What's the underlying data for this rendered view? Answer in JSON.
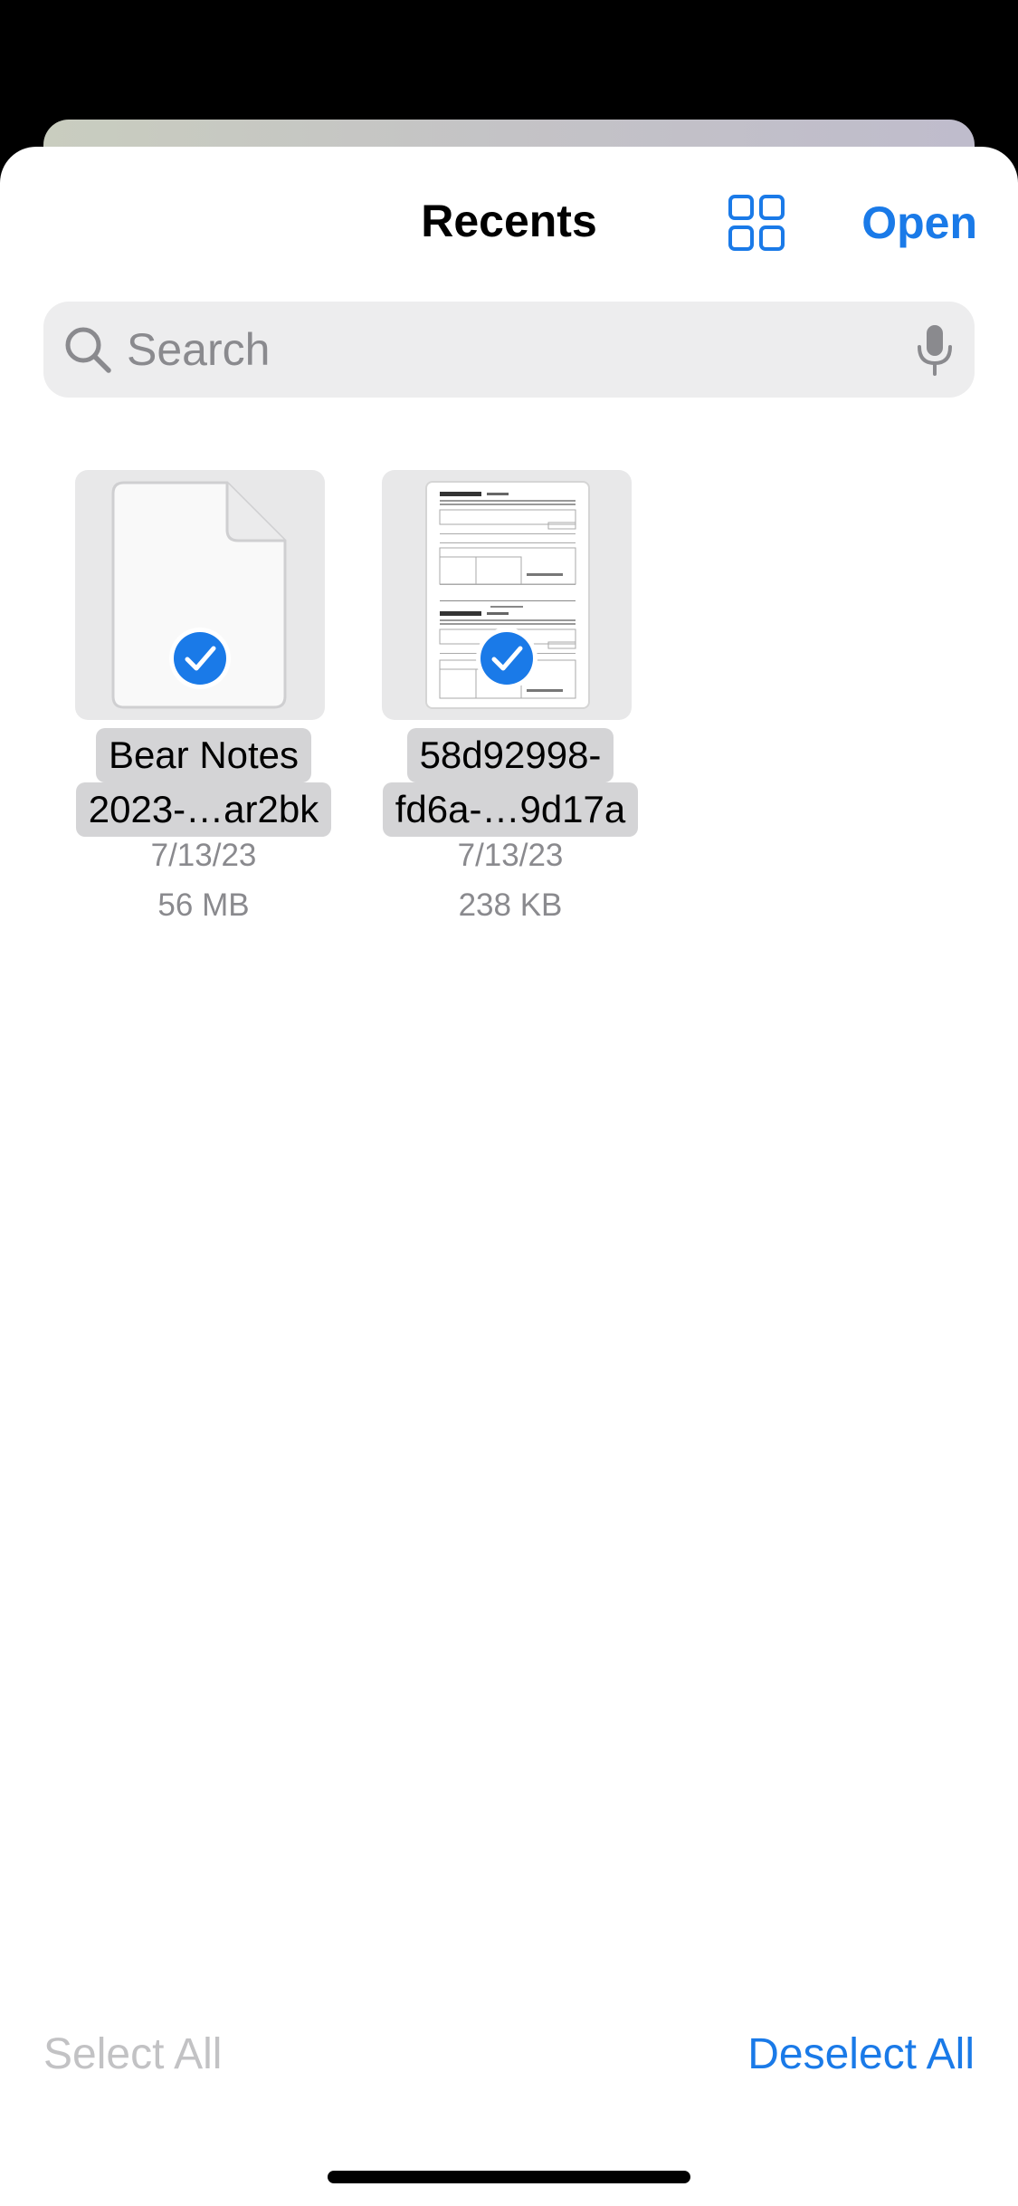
{
  "header": {
    "title": "Recents",
    "open_label": "Open",
    "grid_icon": "grid-icon"
  },
  "search": {
    "placeholder": "Search",
    "value": "",
    "icon": "search-icon",
    "mic_icon": "mic-icon"
  },
  "files": [
    {
      "name_line1": "Bear Notes",
      "name_line2": "2023-…ar2bk",
      "date": "7/13/23",
      "size": "56 MB",
      "thumbnail": "blank-document-icon",
      "selected": true
    },
    {
      "name_line1": "58d92998-",
      "name_line2": "fd6a-…9d17a",
      "date": "7/13/23",
      "size": "238 KB",
      "thumbnail": "document-preview",
      "selected": true
    }
  ],
  "footer": {
    "select_all_label": "Select All",
    "deselect_all_label": "Deselect All"
  },
  "colors": {
    "accent": "#1a7ae8",
    "disabled": "#c2c2c4",
    "secondary_text": "#8a8a8e",
    "search_bg": "#ededee"
  }
}
